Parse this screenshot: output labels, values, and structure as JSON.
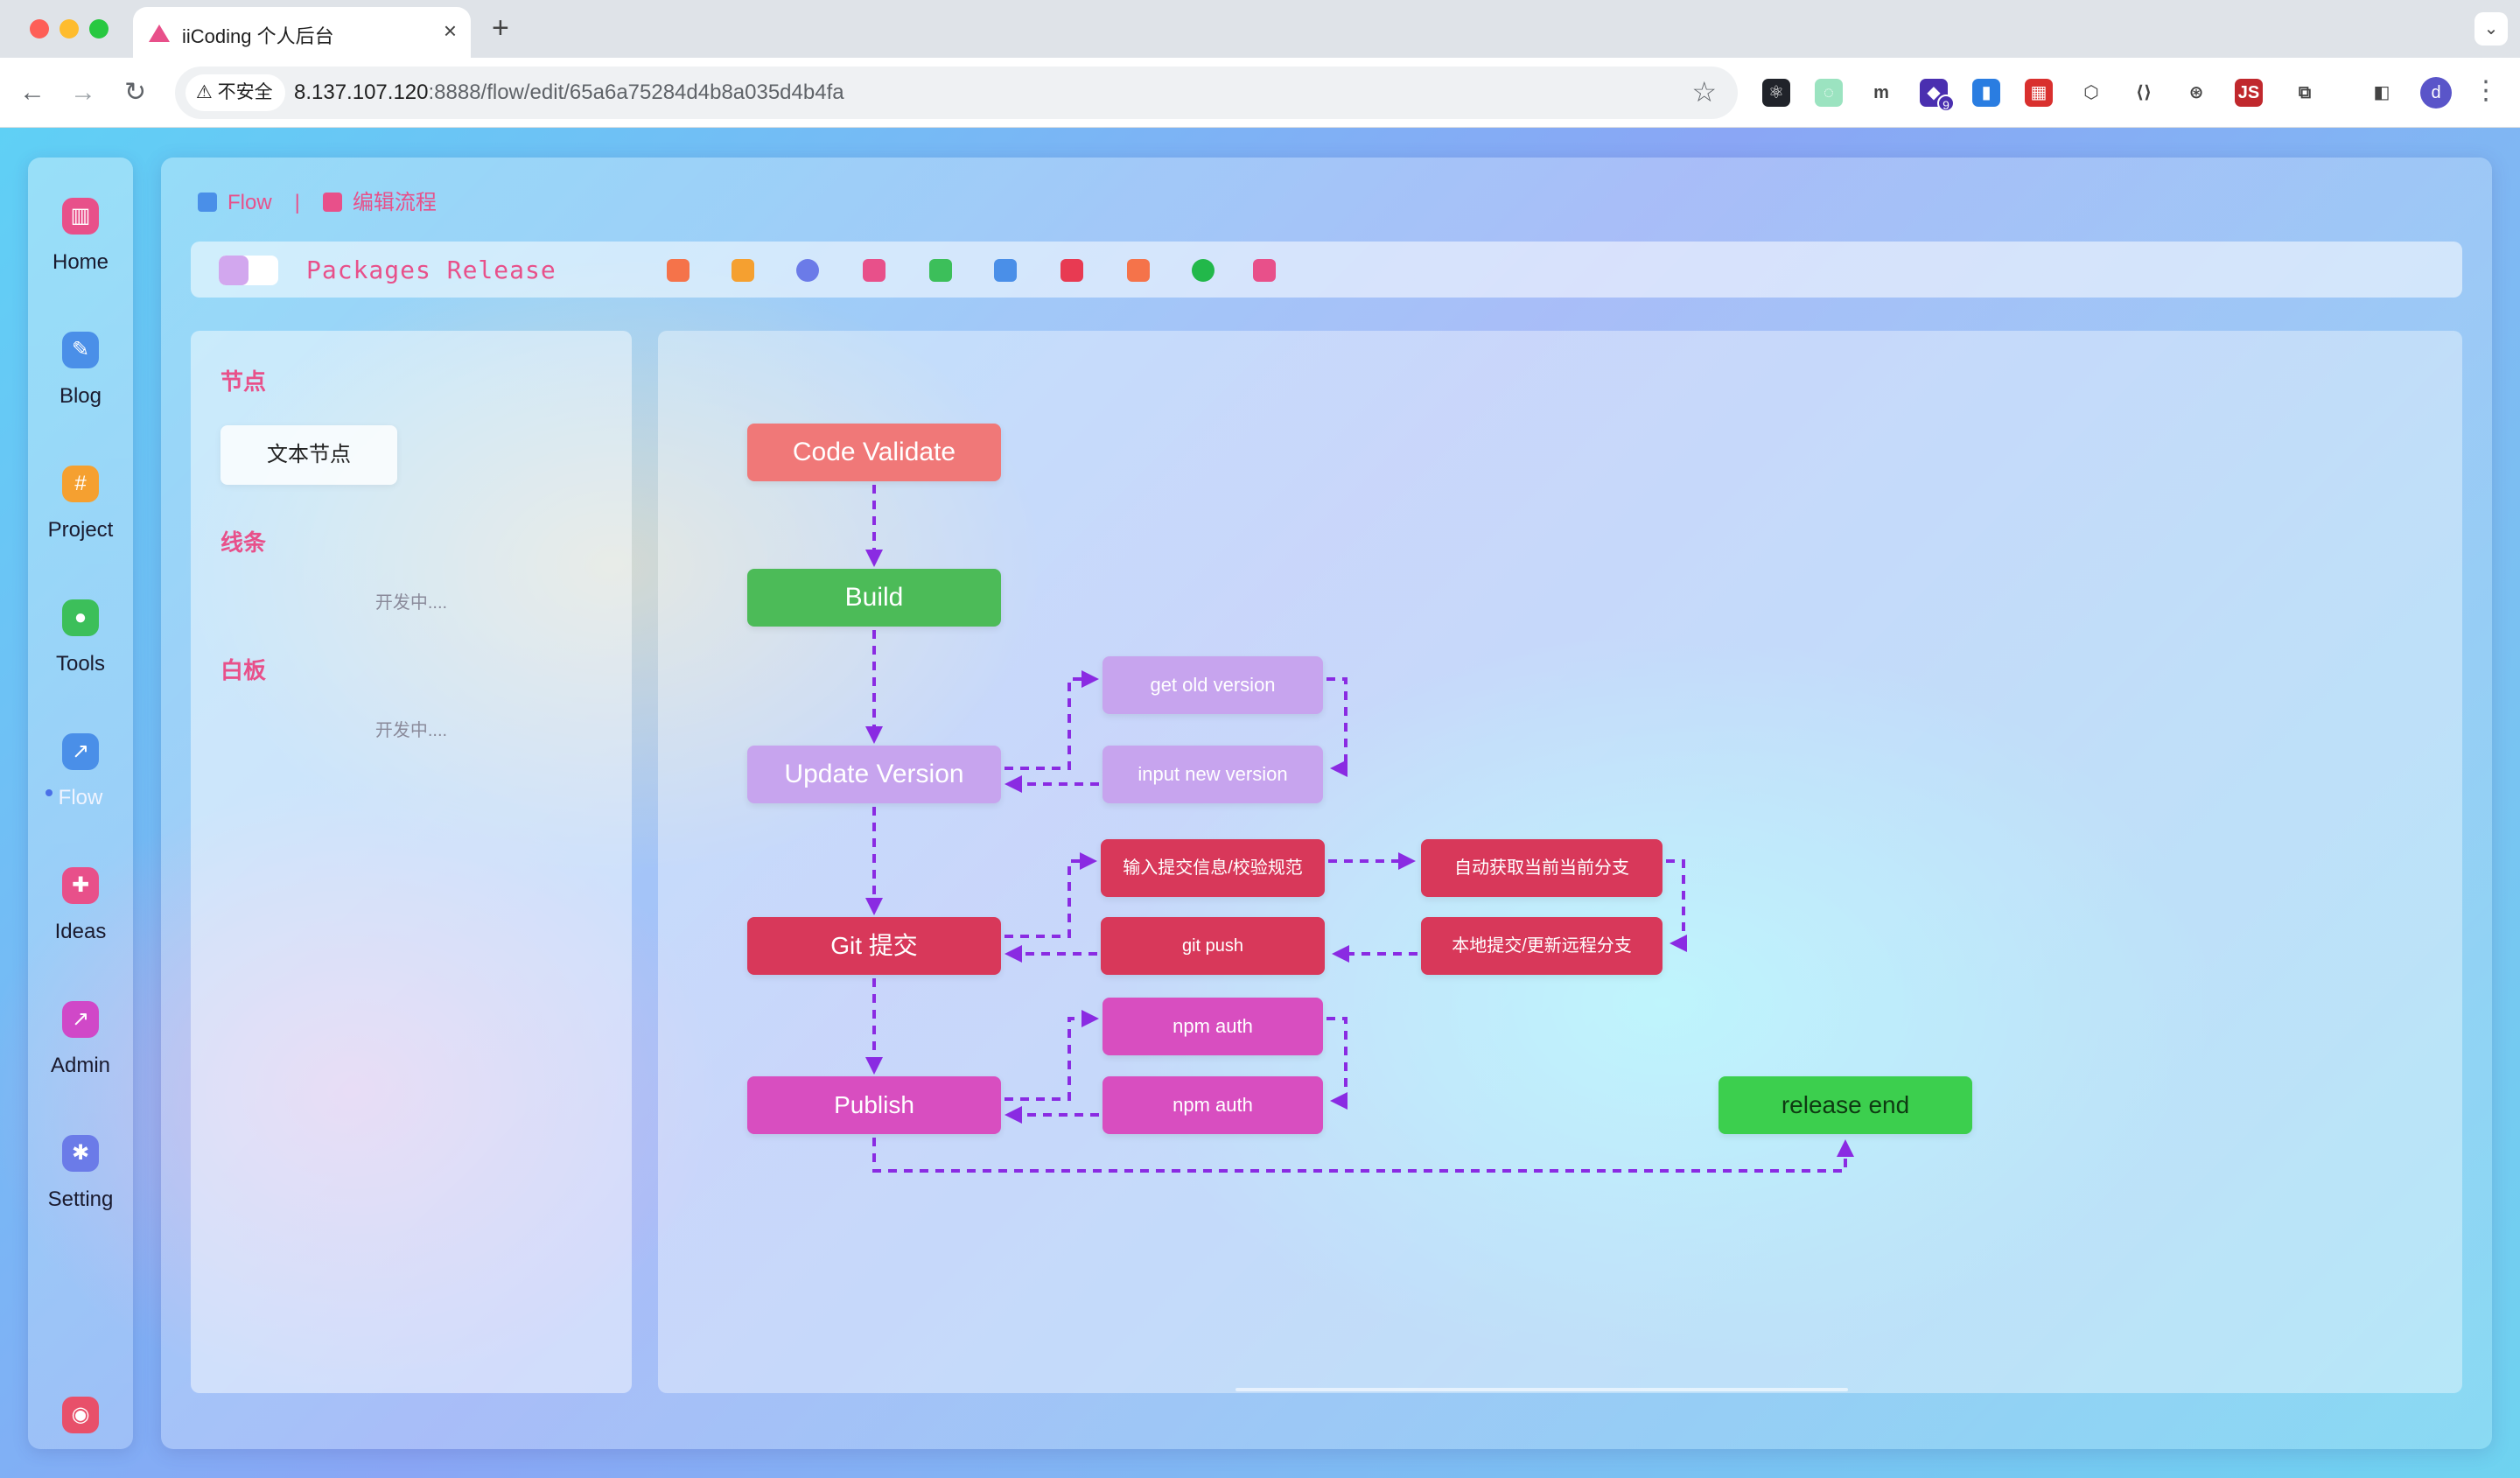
{
  "browser": {
    "tab_title": "iiCoding 个人后台",
    "tab_close": "×",
    "new_tab": "+",
    "tab_menu": "⌄",
    "back": "←",
    "forward": "→",
    "reload": "↻",
    "insecure_label": "⚠ 不安全",
    "url_host": "8.137.107.120",
    "url_rest": ":8888/flow/edit/65a6a75284d4b8a035d4b4fa",
    "bookmark_icon": "☆",
    "profile_initial": "d",
    "menu_icon": "⋮",
    "extensions": [
      {
        "name": "react-devtools-icon",
        "color": "#20232a",
        "glyph": "⚛"
      },
      {
        "name": "ext-green-circle-icon",
        "color": "#9be3c0",
        "glyph": "◌"
      },
      {
        "name": "ext-m-icon",
        "color": "#ffffff",
        "glyph": "m"
      },
      {
        "name": "ext-badge-icon",
        "color": "#4a2fb0",
        "glyph": "◆",
        "badge": "9"
      },
      {
        "name": "ext-lock-icon",
        "color": "#2a7de1",
        "glyph": "▮"
      },
      {
        "name": "ext-red-grid-icon",
        "color": "#d9302e",
        "glyph": "▦"
      },
      {
        "name": "ext-cube-icon",
        "color": "#ffffff",
        "glyph": "⬡"
      },
      {
        "name": "ext-code-icon",
        "color": "#ffffff",
        "glyph": "⟨⟩"
      },
      {
        "name": "ext-wheel-icon",
        "color": "#ffffff",
        "glyph": "⊛"
      },
      {
        "name": "ext-js-icon",
        "color": "#c0282d",
        "glyph": "JS"
      },
      {
        "name": "extensions-puzzle-icon",
        "color": "#ffffff",
        "glyph": "⧉"
      },
      {
        "name": "sidepanel-icon",
        "color": "#ffffff",
        "glyph": "◧"
      }
    ]
  },
  "sidebar": {
    "items": [
      {
        "label": "Home",
        "icon": "chart-icon",
        "color": "#e8508a",
        "glyph": "▥"
      },
      {
        "label": "Blog",
        "icon": "edit-icon",
        "color": "#4a8fe8",
        "glyph": "✎"
      },
      {
        "label": "Project",
        "icon": "hash-icon",
        "color": "#f5a030",
        "glyph": "#"
      },
      {
        "label": "Tools",
        "icon": "apple-icon",
        "color": "#3cbf5a",
        "glyph": "●"
      },
      {
        "label": "Flow",
        "icon": "flow-icon",
        "color": "#4a8fe8",
        "glyph": "↗"
      },
      {
        "label": "Ideas",
        "icon": "gamepad-icon",
        "color": "#e8508a",
        "glyph": "✚"
      },
      {
        "label": "Admin",
        "icon": "monitor-icon",
        "color": "#d048c8",
        "glyph": "↗"
      },
      {
        "label": "Setting",
        "icon": "gear-icon",
        "color": "#6b7be8",
        "glyph": "✱"
      }
    ],
    "user_icon": "users-icon",
    "user_glyph": "◉"
  },
  "breadcrumb": {
    "item1": "Flow",
    "separator": "|",
    "item2": "编辑流程"
  },
  "flowbar": {
    "title": "Packages Release",
    "tools": [
      {
        "name": "prev-icon",
        "color": "#f5734a"
      },
      {
        "name": "next-icon",
        "color": "#f5a030"
      },
      {
        "name": "sync-icon",
        "color": "#6b7be8"
      },
      {
        "name": "slides-icon",
        "color": "#e8508a"
      },
      {
        "name": "check-icon",
        "color": "#3cbf5a"
      },
      {
        "name": "document-icon",
        "color": "#4a8fe8"
      },
      {
        "name": "activity-icon",
        "color": "#e83a52"
      },
      {
        "name": "image-icon",
        "color": "#f5734a"
      },
      {
        "name": "play-icon",
        "color": "#22b84a"
      },
      {
        "name": "calendar-icon",
        "color": "#e8508a"
      }
    ]
  },
  "panel": {
    "nodes_heading": "节点",
    "text_node": "文本节点",
    "lines_heading": "线条",
    "lines_status": "开发中....",
    "board_heading": "白板",
    "board_status": "开发中...."
  },
  "flow": {
    "nodes": [
      {
        "id": "code-validate",
        "label": "Code  Validate",
        "color": "#f07878"
      },
      {
        "id": "build",
        "label": "Build",
        "color": "#4cbb58"
      },
      {
        "id": "get-old-version",
        "label": "get  old  version",
        "color": "#c7a4ee"
      },
      {
        "id": "update-version",
        "label": "Update  Version",
        "color": "#c7a4ee"
      },
      {
        "id": "input-new-version",
        "label": "input  new  version",
        "color": "#c7a4ee"
      },
      {
        "id": "commit-validate",
        "label": "输入提交信息/校验规范",
        "color": "#d8385a"
      },
      {
        "id": "auto-branch",
        "label": "自动获取当前当前分支",
        "color": "#d8385a"
      },
      {
        "id": "git-commit",
        "label": "Git  提交",
        "color": "#d8385a"
      },
      {
        "id": "git-push",
        "label": "git  push",
        "color": "#d8385a"
      },
      {
        "id": "local-commit",
        "label": "本地提交/更新远程分支",
        "color": "#d8385a"
      },
      {
        "id": "npm-auth-1",
        "label": "npm  auth",
        "color": "#d84ec0"
      },
      {
        "id": "publish",
        "label": "Publish",
        "color": "#d84ec0"
      },
      {
        "id": "npm-auth-2",
        "label": "npm  auth",
        "color": "#d84ec0"
      },
      {
        "id": "release-end",
        "label": "release  end",
        "color": "#3ccf4e"
      }
    ],
    "line_color": "#8a2be2"
  }
}
